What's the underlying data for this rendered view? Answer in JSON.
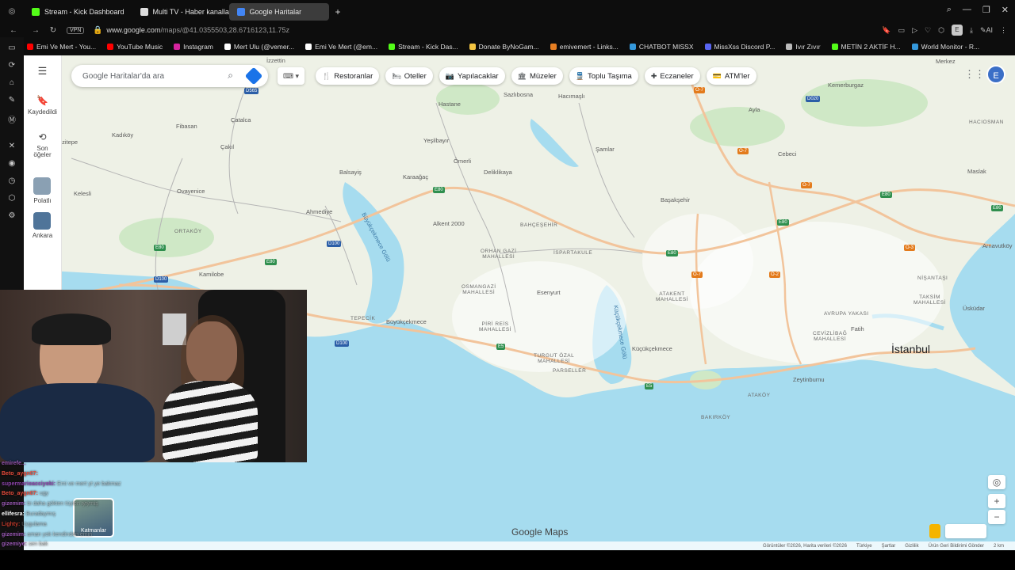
{
  "tabs": [
    {
      "label": "Stream - Kick Dashboard",
      "color": "#53fc18"
    },
    {
      "label": "Multi TV - Haber kanalları",
      "color": "#dddddd"
    },
    {
      "label": "Google Haritalar",
      "color": "#4285f4"
    }
  ],
  "address": {
    "vpn": "VPN",
    "url_host": "www.google.com",
    "url_path": "/maps/@41.0355503,28.6716123,11.75z"
  },
  "profile_initial": "E",
  "bookmarks": [
    {
      "label": "Emi Ve Mert - You...",
      "color": "#ff0000"
    },
    {
      "label": "YouTube Music",
      "color": "#ff0000"
    },
    {
      "label": "Instagram",
      "color": "#d6249f"
    },
    {
      "label": "Mert Ulu (@vemer...",
      "color": "#ffffff"
    },
    {
      "label": "Emi Ve Mert (@em...",
      "color": "#ffffff"
    },
    {
      "label": "Stream - Kick Das...",
      "color": "#53fc18"
    },
    {
      "label": "Donate ByNoGam...",
      "color": "#f4c542"
    },
    {
      "label": "emivemert - Links...",
      "color": "#e67e22"
    },
    {
      "label": "CHATBOT MISSX",
      "color": "#3498db"
    },
    {
      "label": "MissXss Discord P...",
      "color": "#5865f2"
    },
    {
      "label": "Ivır Zıvır",
      "color": "#bbbbbb"
    },
    {
      "label": "METİN 2 AKTİF H...",
      "color": "#53fc18"
    },
    {
      "label": "World Monitor - R...",
      "color": "#3498db"
    }
  ],
  "maps": {
    "search_placeholder": "Google Haritalar'da ara",
    "chips": [
      {
        "icon": "🍴",
        "label": "Restoranlar"
      },
      {
        "icon": "🛏",
        "label": "Oteller"
      },
      {
        "icon": "📷",
        "label": "Yapılacaklar"
      },
      {
        "icon": "🏛",
        "label": "Müzeler"
      },
      {
        "icon": "🚆",
        "label": "Toplu Taşıma"
      },
      {
        "icon": "✚",
        "label": "Eczaneler"
      },
      {
        "icon": "💳",
        "label": "ATM'ler"
      }
    ],
    "sidebar": {
      "saved": "Kaydedildi",
      "recent_line1": "Son",
      "recent_line2": "öğeler",
      "polatli": "Polatlı",
      "ankara": "Ankara"
    },
    "avatar_initial": "E",
    "layers_label": "Katmanlar",
    "logo": "Google Maps",
    "footer": [
      "Görüntüler ©2026, Harita verileri ©2026",
      "Türkiye",
      "Şartlar",
      "Gizlilik",
      "Ürün Geri Bildirimi Gönder",
      "2 km"
    ],
    "places": {
      "izzettin": "İzzettin",
      "hastane": "Hastane",
      "sazlibosna": "Sazlıbosna",
      "hacimasli": "Hacımaşlı",
      "fibasan": "Fibasan",
      "catalca": "Çatalca",
      "kadikoy": "Kadıköy",
      "yesilbayir": "Yeşilbayır",
      "samlar": "Şamlar",
      "cebeci": "Cebeci",
      "kemerburgaz": "Kemerburgaz",
      "markez": "Merkez",
      "ayla": "Ayla",
      "hacioman": "HACIOSMAN",
      "izitepe": "İzitepe",
      "cakil": "Çakıl",
      "omerli": "Ömerli",
      "delikliyaka": "Deliklikaya",
      "maslak": "Maslak",
      "balsayis": "Balsayiş",
      "karaagac": "Karaağaç",
      "basaksehir": "Başakşehir",
      "kelesli": "Kelesli",
      "ovayenice": "Ovayenice",
      "ahmediye": "Ahmediye",
      "alkent": "Alkent 2000",
      "bahcesehir": "BAHÇEŞEHİR",
      "arnavutkoy": "Arnavutköy",
      "ortakoy": "ORTAKÖY",
      "orhangazi": "ORHAN GAZİ\nMAHALLESİ",
      "ispartakule": "İSPARTAKULE",
      "kamilobe": "Kamilobe",
      "nisantasi": "NİŞANTAŞI",
      "osmangazi": "OSMANGAZİ\nMAHALLESİ",
      "esenyurt": "Esenyurt",
      "atakent": "ATAKENT\nMAHALLESİ",
      "taksim": "TAKSİM\nMAHALLESİ",
      "uskudar": "Üsküdar",
      "avrupayakasi": "AVRUPA YAKASI",
      "tepecik": "TEPECİK",
      "buyukcekmece": "Büyükçekmece",
      "piris": "PİRİ REİS\nMAHALLESİ",
      "fatih": "Fatih",
      "cevizlibag": "CEVİZLİBAĞ\nMAHALLESİ",
      "kucukcekmece": "Küçükçekmece",
      "istanbul": "İstanbul",
      "turgutozal": "TURGUT ÖZAL\nMAHALLESİ",
      "parseller": "PARSELLER",
      "zeytinburnu": "Zeytinburnu",
      "atakoy": "ATAKÖY",
      "bakirkoy": "BAKIRKÖY",
      "lake_b": "Büyükçekmece Gölü",
      "lake_k": "Küçükçekmece Gölü"
    },
    "roads": {
      "d565": "D565",
      "o7a": "O-7",
      "e80a": "E80",
      "o7b": "O-7",
      "o7c": "O-7",
      "d020": "D020",
      "e80b": "E80",
      "d100a": "D100",
      "e80c": "E80",
      "e80d": "E80",
      "e80e": "E80",
      "e80f": "E80",
      "o7d": "O-7",
      "o2a": "O-2",
      "d100b": "D100",
      "d100c": "D100",
      "e5a": "E5",
      "e5b": "E5",
      "o3": "O-3",
      "e80g": "E80"
    }
  },
  "chat": [
    {
      "user": "emirefe...",
      "color": "#9b59b6",
      "msg": ""
    },
    {
      "user": "Beto_aygn07:",
      "color": "#e74c3c",
      "msg": ""
    },
    {
      "user": "supermarioacciyoki:",
      "color": "#8e44ad",
      "msg": "Emi ve mert yt ye bakmaz"
    },
    {
      "user": "Beto_aygn07:",
      "color": "#e74c3c",
      "msg": "ugy"
    },
    {
      "user": "gizemim:",
      "color": "#9b59b6",
      "msg": "bi daha gökten tüylen iyiymiş"
    },
    {
      "user": "ellifesra:",
      "color": "#ffffff",
      "msg": "Buradaymış"
    },
    {
      "user": "Lighty:",
      "color": "#c0392b",
      "msg": "Uygulama"
    },
    {
      "user": "gizemim:",
      "color": "#9b59b6",
      "msg": "aman yok kendinden emin"
    },
    {
      "user": "gizemiye:",
      "color": "#9b59b6",
      "msg": "sen bak"
    },
    {
      "user": "gizemim:",
      "color": "#9b59b6",
      "msg": "Hareket"
    },
    {
      "user": "KOM4NNN:",
      "color": "#ffffff",
      "msg": "dsfsdddffDSFsdf"
    },
    {
      "user": "ellifesra:",
      "color": "#ffffff",
      "msg": "otobus nerde mert"
    }
  ],
  "colors": {
    "water": "#a6dcef",
    "land": "#eef1e6",
    "highway": "#f2c49b",
    "road": "#ffffff",
    "green": "#cfe8c6"
  }
}
